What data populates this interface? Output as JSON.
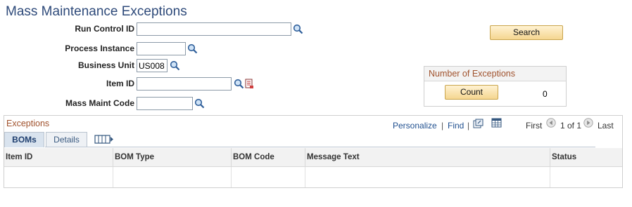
{
  "page": {
    "title": "Mass Maintenance Exceptions"
  },
  "form": {
    "run_control_id": {
      "label": "Run Control ID",
      "value": ""
    },
    "process_instance": {
      "label": "Process Instance",
      "value": ""
    },
    "business_unit": {
      "label": "Business Unit",
      "value": "US008"
    },
    "item_id": {
      "label": "Item ID",
      "value": ""
    },
    "mass_maint_code": {
      "label": "Mass Maint Code",
      "value": ""
    }
  },
  "actions": {
    "search_label": "Search"
  },
  "exceptions_count": {
    "title": "Number of Exceptions",
    "count_button_label": "Count",
    "value": "0"
  },
  "grid": {
    "title": "Exceptions",
    "toolbar": {
      "personalize": "Personalize",
      "separator": "|",
      "find": "Find",
      "first": "First",
      "range": "1 of 1",
      "last": "Last"
    },
    "tabs": [
      {
        "label": "BOMs",
        "active": true
      },
      {
        "label": "Details",
        "active": false
      }
    ],
    "columns": [
      "Item ID",
      "BOM Type",
      "BOM Code",
      "Message Text",
      "Status"
    ],
    "rows": []
  },
  "icons": {
    "lookup": "magnifier-icon",
    "item_detail": "document-icon",
    "view_all": "view-all-icon",
    "download": "spreadsheet-icon",
    "prev": "prev-arrow-icon",
    "next": "next-arrow-icon",
    "show_all_columns": "show-all-columns-icon"
  },
  "colors": {
    "title": "#2e4a7a",
    "section_title": "#a0522d",
    "link": "#1f4f8f",
    "button_bg": "#f5d690"
  }
}
